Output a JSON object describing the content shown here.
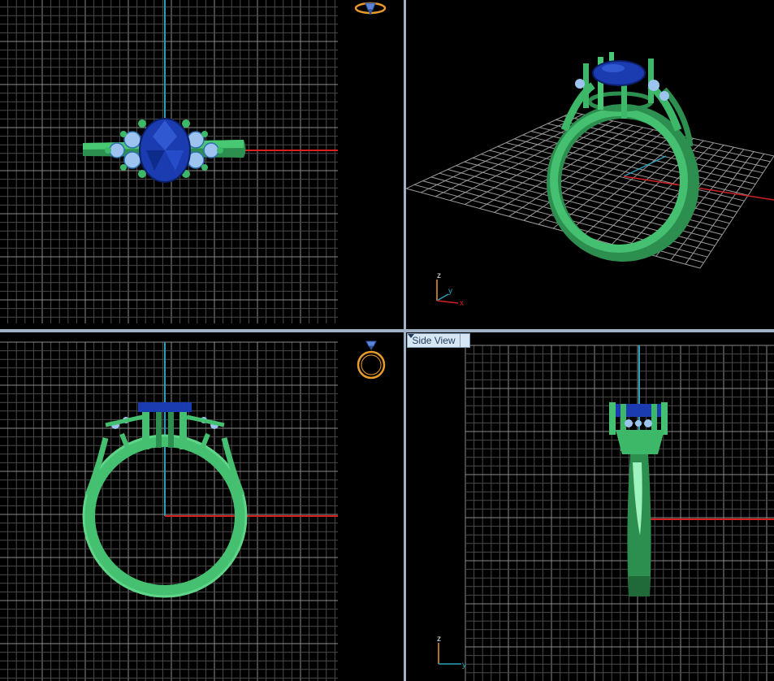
{
  "viewports": {
    "top_left": {
      "name": "top"
    },
    "top_right": {
      "name": "perspective",
      "axis_labels": {
        "z": "z",
        "y": "y",
        "x": "x"
      }
    },
    "bottom_left": {
      "name": "front"
    },
    "bottom_right": {
      "name": "side",
      "menu_label": "Side View",
      "axis_labels": {
        "z": "z",
        "y": "y"
      }
    }
  },
  "icons": {
    "top_view_cube": "ring-top-view-cube-icon",
    "front_view_cube": "ring-front-view-cube-icon",
    "menu_dropdown": "chevron-down-icon"
  },
  "colors": {
    "background": "#000000",
    "grid": "#6e6e6e",
    "axis_y": "#2aa0b8",
    "axis_x": "#d42020",
    "metal": "#3cb868",
    "metal_light": "#6fe095",
    "gem_blue": "#1a3cb0",
    "gem_light": "#9cc4ee",
    "divider": "#9fb3c8"
  }
}
